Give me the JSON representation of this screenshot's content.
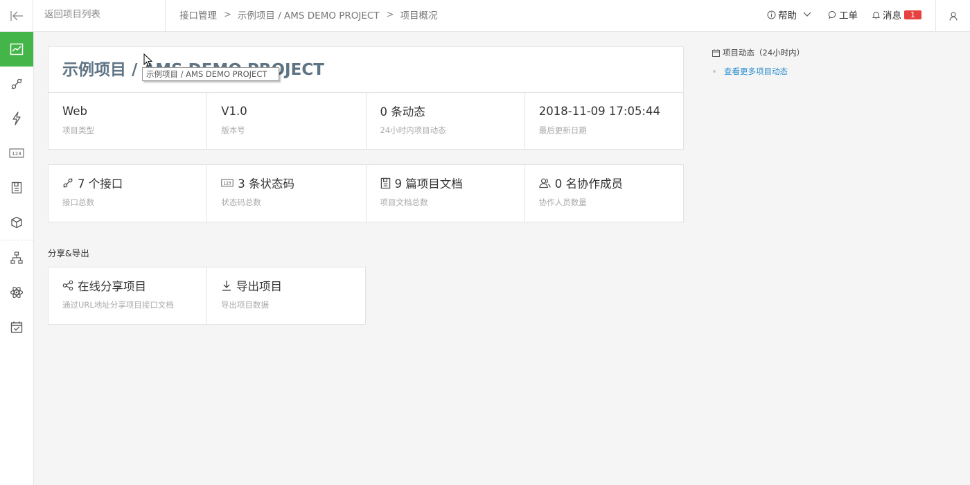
{
  "topbar": {
    "back_label": "返回项目列表",
    "breadcrumb": [
      "接口管理",
      "示例项目 / AMS DEMO PROJECT",
      "项目概况"
    ],
    "breadcrumb_sep": ">",
    "help_label": "帮助",
    "ticket_label": "工单",
    "message_label": "消息",
    "message_count": "1"
  },
  "sidebar": {
    "items": [
      "overview",
      "api",
      "automation",
      "status-code",
      "document",
      "package",
      "structure",
      "atom",
      "calendar"
    ],
    "active": "overview",
    "accent": "#44b549"
  },
  "project": {
    "title": "示例项目 / AMS DEMO PROJECT",
    "info": [
      {
        "value": "Web",
        "label": "项目类型"
      },
      {
        "value": "V1.0",
        "label": "版本号"
      },
      {
        "value": "0 条动态",
        "label": "24小时内项目动态"
      },
      {
        "value": "2018-11-09 17:05:44",
        "label": "最后更新日期"
      }
    ]
  },
  "stats": [
    {
      "value": "7 个接口",
      "label": "接口总数",
      "icon": "link-icon"
    },
    {
      "value": "3 条状态码",
      "label": "状态码总数",
      "icon": "status-code-icon"
    },
    {
      "value": "9 篇项目文档",
      "label": "项目文档总数",
      "icon": "document-icon"
    },
    {
      "value": "0 名协作成员",
      "label": "协作人员数量",
      "icon": "members-icon"
    }
  ],
  "share_section": {
    "title": "分享&导出",
    "items": [
      {
        "value": "在线分享项目",
        "label": "通过URL地址分享项目接口文档",
        "icon": "share-icon"
      },
      {
        "value": "导出项目",
        "label": "导出项目数据",
        "icon": "download-icon"
      }
    ]
  },
  "activity": {
    "title": "项目动态（24小时内）",
    "more_link": "查看更多项目动态"
  },
  "tooltip": {
    "text": "示例项目 / AMS DEMO PROJECT"
  },
  "colors": {
    "link": "#2b8ccf",
    "badge": "#e64242",
    "title": "#5e7485"
  }
}
